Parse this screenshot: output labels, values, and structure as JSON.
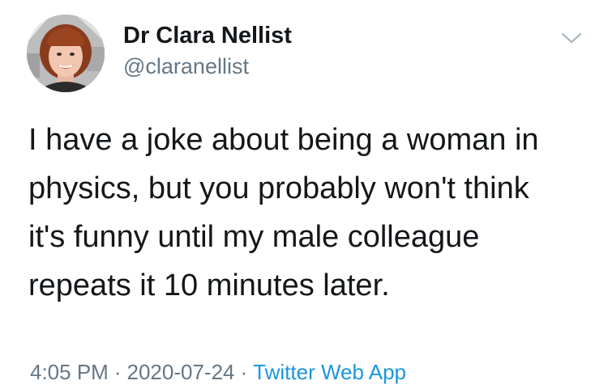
{
  "tweet": {
    "author": {
      "display_name": "Dr Clara Nellist",
      "handle": "@claranellist"
    },
    "text_lines": [
      "I have a joke about being a woman in",
      "physics, but you probably won't think",
      "it's funny until my male colleague",
      "repeats it 10 minutes later."
    ],
    "time": "4:05 PM",
    "date": "2020-07-24",
    "separator": "·",
    "source": "Twitter Web App"
  },
  "icons": {
    "menu": "chevron-down-icon"
  },
  "colors": {
    "text_primary": "#14171a",
    "text_secondary": "#657786",
    "link": "#1b95e0",
    "background": "#ffffff"
  }
}
